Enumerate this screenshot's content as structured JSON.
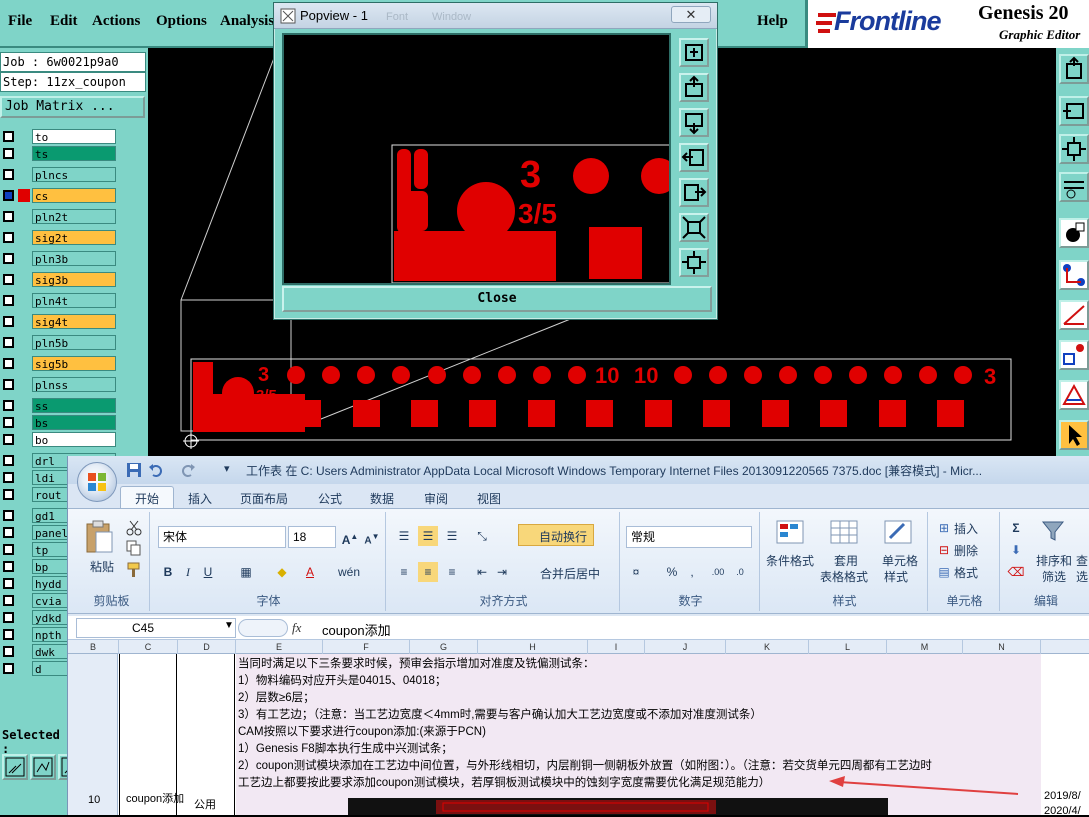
{
  "menu": {
    "items": [
      "File",
      "Edit",
      "Actions",
      "Options",
      "Analysis",
      "Help"
    ]
  },
  "brand": {
    "logo": "Frontline",
    "product": "Genesis 20",
    "subtitle": "Graphic Editor"
  },
  "job_panel": {
    "job": "Job : 6w0021p9a0",
    "step": "Step: 11zx_coupon",
    "job_matrix_button": "Job Matrix ...",
    "layers": [
      {
        "name": "to",
        "color": "#ffffff"
      },
      {
        "name": "ts",
        "color": "#0a9a70"
      },
      {
        "name": "plncs",
        "color": "#7fd4c8"
      },
      {
        "name": "cs",
        "color": "#ffc040"
      },
      {
        "name": "pln2t",
        "color": "#7fd4c8"
      },
      {
        "name": "sig2t",
        "color": "#ffc040"
      },
      {
        "name": "pln3b",
        "color": "#7fd4c8"
      },
      {
        "name": "sig3b",
        "color": "#ffc040"
      },
      {
        "name": "pln4t",
        "color": "#7fd4c8"
      },
      {
        "name": "sig4t",
        "color": "#ffc040"
      },
      {
        "name": "pln5b",
        "color": "#7fd4c8"
      },
      {
        "name": "sig5b",
        "color": "#ffc040"
      },
      {
        "name": "plnss",
        "color": "#7fd4c8"
      },
      {
        "name": "ss",
        "color": "#0a9a70"
      },
      {
        "name": "bs",
        "color": "#0a9a70"
      },
      {
        "name": "bo",
        "color": "#ffffff"
      },
      {
        "name": "drl",
        "color": "#7fd4c8"
      },
      {
        "name": "ldi",
        "color": "#7fd4c8"
      },
      {
        "name": "rout",
        "color": "#7fd4c8"
      },
      {
        "name": "gd1",
        "color": "#7fd4c8"
      },
      {
        "name": "panel",
        "color": "#7fd4c8"
      },
      {
        "name": "tp",
        "color": "#7fd4c8"
      },
      {
        "name": "bp",
        "color": "#7fd4c8"
      },
      {
        "name": "hydd",
        "color": "#7fd4c8"
      },
      {
        "name": "cvia",
        "color": "#7fd4c8"
      },
      {
        "name": "ydkd",
        "color": "#7fd4c8"
      },
      {
        "name": "npth",
        "color": "#7fd4c8"
      },
      {
        "name": "dwk",
        "color": "#7fd4c8"
      },
      {
        "name": "d",
        "color": "#7fd4c8"
      }
    ],
    "selected_label": "Selected :"
  },
  "popview": {
    "title": "Popview - 1",
    "close_button": "Close",
    "bg_menu": [
      "Font",
      "Window"
    ]
  },
  "canvas": {
    "labels": [
      "10",
      "10",
      "3"
    ]
  },
  "excel": {
    "title": "工作表 在 C: Users Administrator AppData Local Microsoft Windows Temporary Internet Files 2013091220565 7375.doc [兼容模式] - Micr...",
    "tabs": [
      "开始",
      "插入",
      "页面布局",
      "公式",
      "数据",
      "审阅",
      "视图"
    ],
    "ribbon": {
      "clipboard": {
        "paste": "粘贴",
        "label": "剪贴板"
      },
      "font": {
        "name": "宋体",
        "size": "18",
        "label": "字体"
      },
      "align": {
        "wrap": "自动换行",
        "merge": "合并后居中",
        "label": "对齐方式"
      },
      "number": {
        "format": "常规",
        "label": "数字"
      },
      "styles": {
        "cond": "条件格式",
        "table1": "套用",
        "table2": "表格格式",
        "cell1": "单元格",
        "cell2": "样式",
        "label": "样式"
      },
      "cells": {
        "insert": "插入",
        "delete": "删除",
        "format": "格式",
        "label": "单元格"
      },
      "editing": {
        "sort1": "排序和",
        "sort2": "筛选",
        "find": "查",
        "find2": "选",
        "label": "编辑"
      }
    },
    "namebox": "C45",
    "fx": "fx",
    "formula": "coupon添加",
    "columns": [
      "B",
      "C",
      "D",
      "E",
      "F",
      "G",
      "H",
      "I",
      "J",
      "K",
      "L",
      "M",
      "N"
    ],
    "row_number": "10",
    "cell_c": "coupon添加",
    "cell_d": "公用",
    "lines": [
      "当同时满足以下三条要求时候，预审会指示增加对准度及铣偏测试条：",
      "1）物料编码对应开头是04015、04018；",
      "2）层数≥6层；",
      "3）有工艺边；（注意：当工艺边宽度＜4mm时,需要与客户确认加大工艺边宽度或不添加对准度测试条）",
      "CAM按照以下要求进行coupon添加:(来源于PCN)",
      "1）Genesis F8脚本执行生成中兴测试条；",
      "2）coupon测试模块添加在工艺边中间位置，与外形线相切，内层削铜一侧朝板外放置（如附图：）。（注意：若交货单元四周都有工艺边时",
      "工艺边上都要按此要求添加coupon测试模块，若厚铜板测试模块中的蚀刻字宽度需要优化满足规范能力）"
    ],
    "date1": "2019/8/",
    "date2": "2020/4/"
  },
  "colors": {
    "genesis": "#7fd4c8",
    "copper": "#e00000",
    "excel_blue": "#1e395b"
  }
}
